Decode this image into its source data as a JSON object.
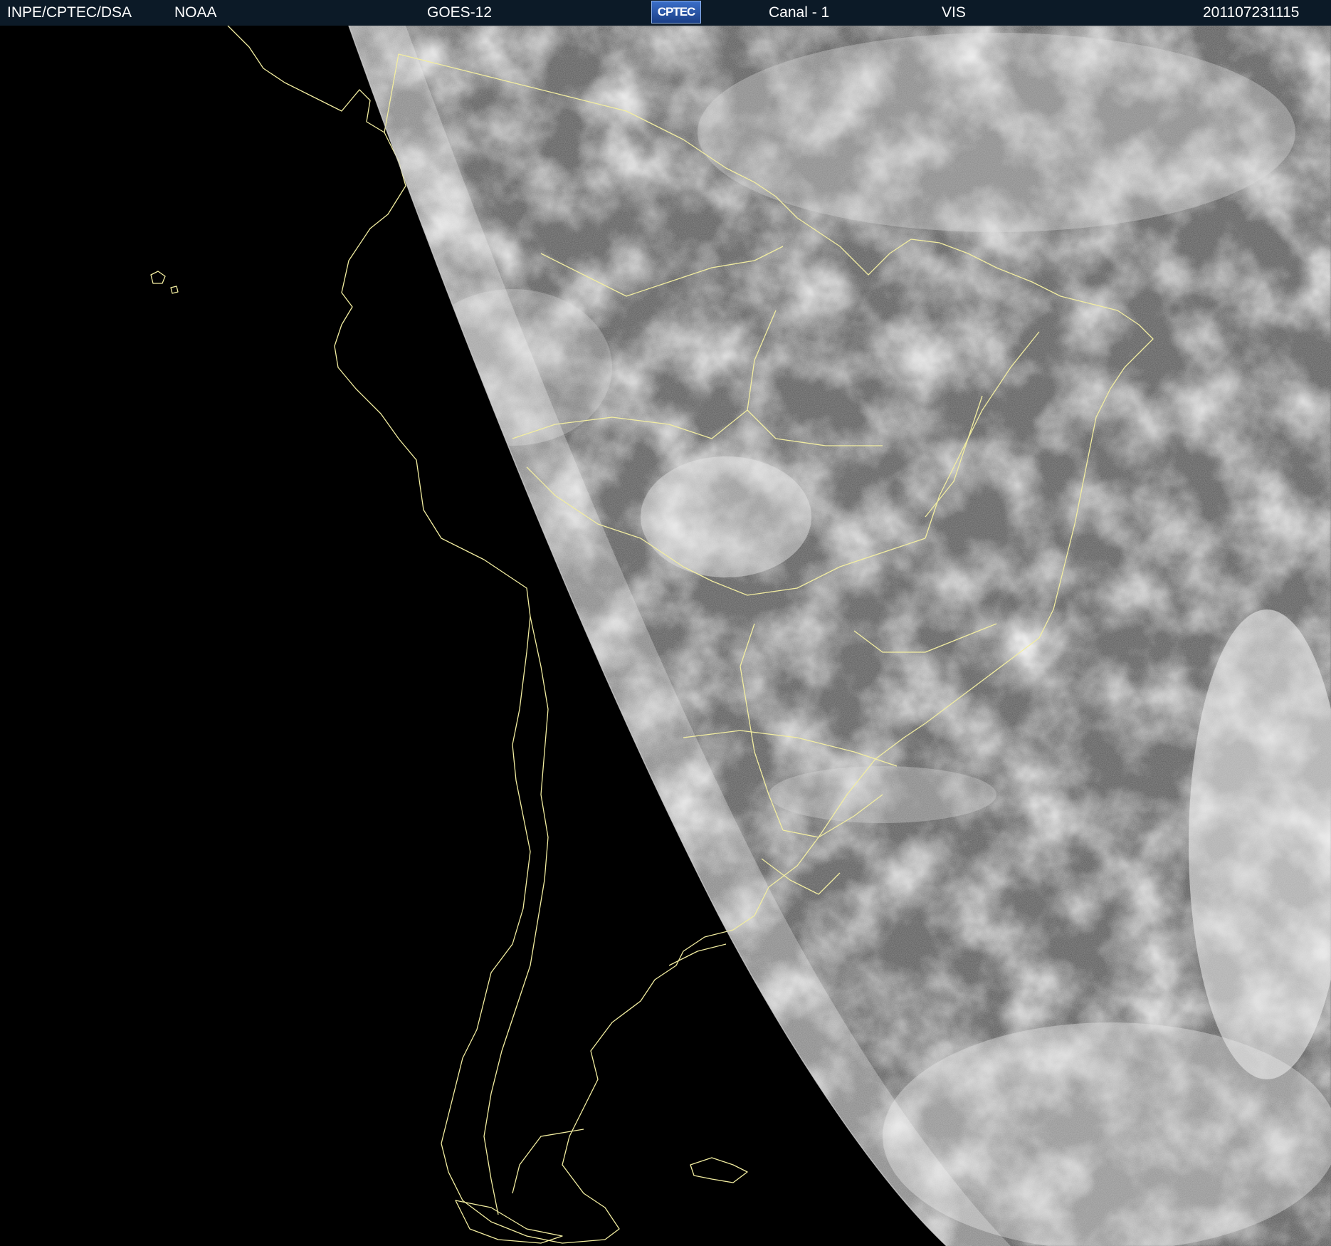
{
  "header": {
    "agency": "INPE/CPTEC/DSA",
    "source": "NOAA",
    "satellite": "GOES-12",
    "logo_text": "CPTEC",
    "channel": "Canal - 1",
    "band": "VIS",
    "timestamp": "201107231115"
  },
  "colors": {
    "header_bg": "#0c1a27",
    "outline": "#f2eda0",
    "space": "#000000",
    "earth_base": "#5a5a5a"
  },
  "icons": {
    "logo": "cptec-logo"
  }
}
